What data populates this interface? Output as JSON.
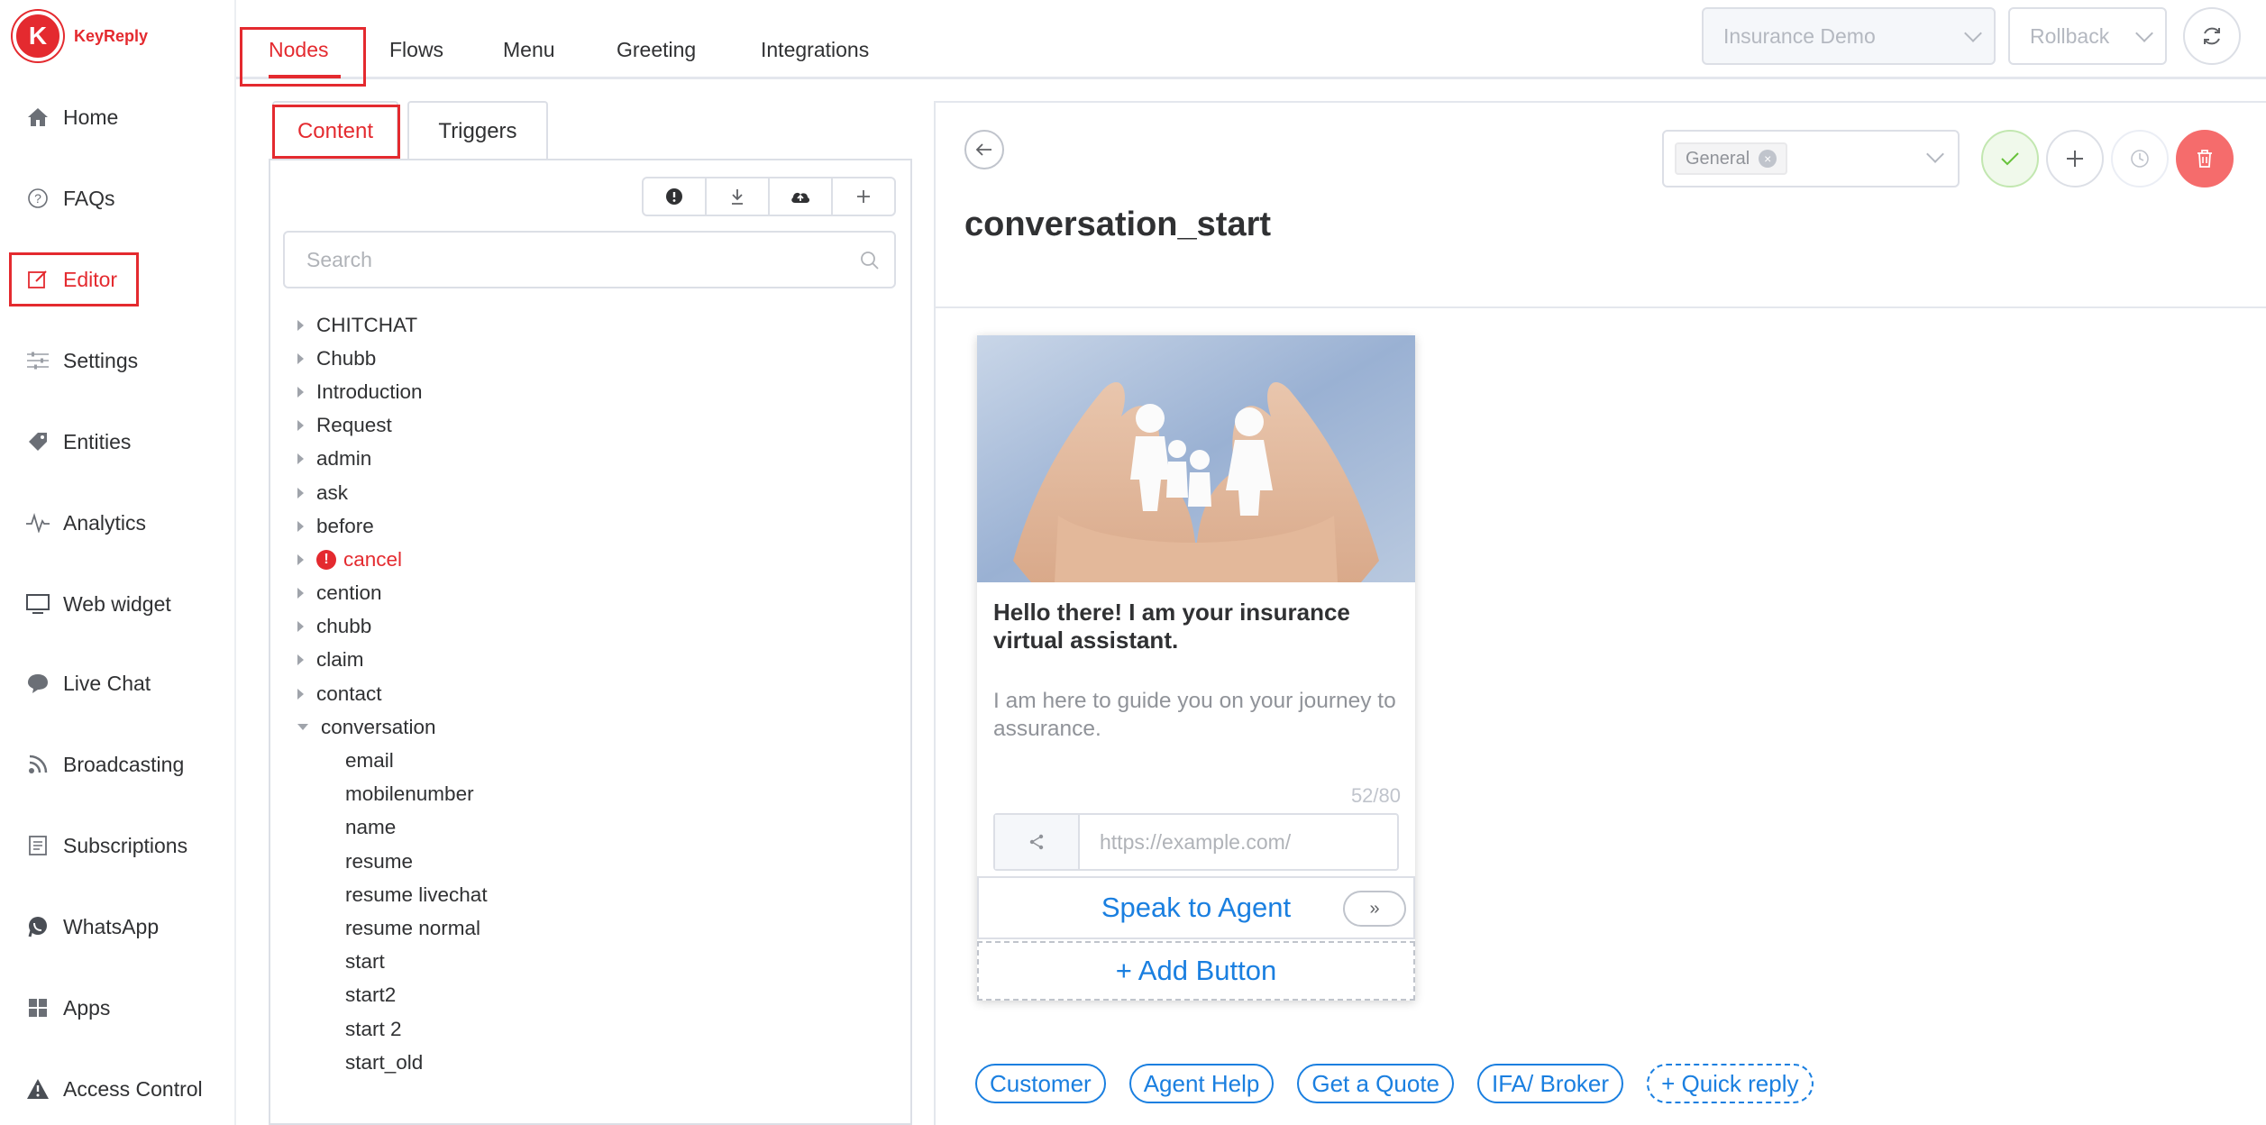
{
  "app": {
    "brand": "KeyReply"
  },
  "sidebar": {
    "items": [
      {
        "label": "Home",
        "icon": "home-icon"
      },
      {
        "label": "FAQs",
        "icon": "question-circle-icon"
      },
      {
        "label": "Editor",
        "icon": "edit-icon",
        "active": true
      },
      {
        "label": "Settings",
        "icon": "sliders-icon"
      },
      {
        "label": "Entities",
        "icon": "tag-icon"
      },
      {
        "label": "Analytics",
        "icon": "pulse-icon"
      },
      {
        "label": "Web widget",
        "icon": "monitor-icon"
      },
      {
        "label": "Live Chat",
        "icon": "chat-bubble-icon"
      },
      {
        "label": "Broadcasting",
        "icon": "rss-icon"
      },
      {
        "label": "Subscriptions",
        "icon": "document-icon"
      },
      {
        "label": "WhatsApp",
        "icon": "whatsapp-icon"
      },
      {
        "label": "Apps",
        "icon": "grid-icon"
      },
      {
        "label": "Access Control",
        "icon": "warning-icon"
      }
    ]
  },
  "top_tabs": {
    "items": [
      {
        "label": "Nodes",
        "active": true
      },
      {
        "label": "Flows"
      },
      {
        "label": "Menu"
      },
      {
        "label": "Greeting"
      },
      {
        "label": "Integrations"
      }
    ]
  },
  "header_controls": {
    "bot_select": "Insurance Demo",
    "rollback_select": "Rollback",
    "refresh_icon": "refresh-icon"
  },
  "content_tabs": {
    "content": "Content",
    "triggers": "Triggers"
  },
  "toolbar": {
    "icons": [
      "alert-icon",
      "download-icon",
      "cloud-upload-icon",
      "plus-icon"
    ]
  },
  "search": {
    "placeholder": "Search"
  },
  "tree": {
    "groups": [
      {
        "label": "CHITCHAT"
      },
      {
        "label": "Chubb"
      },
      {
        "label": "Introduction"
      },
      {
        "label": "Request"
      },
      {
        "label": "admin"
      },
      {
        "label": "ask"
      },
      {
        "label": "before"
      },
      {
        "label": "cancel",
        "warning": true
      },
      {
        "label": "cention"
      },
      {
        "label": "chubb"
      },
      {
        "label": "claim"
      },
      {
        "label": "contact"
      },
      {
        "label": "conversation",
        "expanded": true
      }
    ],
    "children": [
      "email",
      "mobilenumber",
      "name",
      "resume",
      "resume livechat",
      "resume normal",
      "start",
      "start2",
      "start 2",
      "start_old"
    ]
  },
  "node": {
    "title": "conversation_start",
    "tag": "General",
    "card": {
      "title": "Hello there! I am your insurance virtual assistant.",
      "body": "I am here to guide you on your journey to assurance.",
      "char_count": "52/80",
      "url_placeholder": "https://example.com/",
      "button_label": "Speak to Agent",
      "add_button_label": "+ Add Button"
    },
    "quick_replies": [
      "Customer",
      "Agent Help",
      "Get a Quote",
      "IFA/ Broker"
    ],
    "add_quick_reply": "+ Quick reply"
  },
  "colors": {
    "accent_red": "#e42a2f",
    "link_blue": "#1a7fe0",
    "save_green": "#67c23a",
    "delete_red": "#f56c6c"
  }
}
